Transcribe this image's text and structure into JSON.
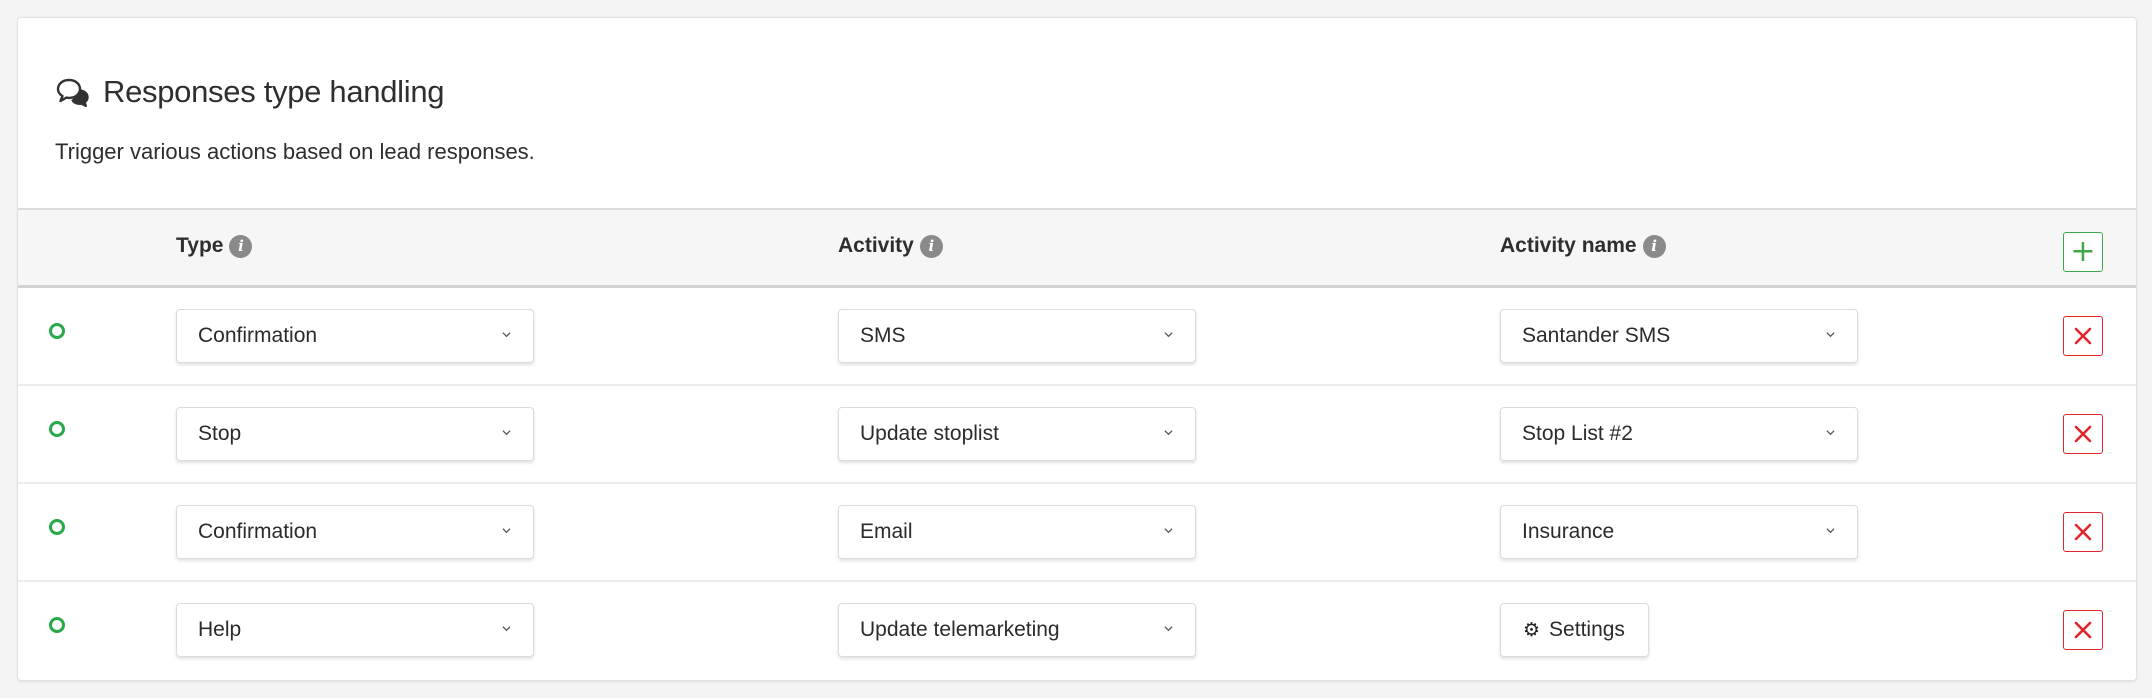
{
  "panel": {
    "title": "Responses type handling",
    "subtitle": "Trigger various actions based on lead responses.",
    "title_icon": "chat-bubbles-icon"
  },
  "columns": {
    "type": "Type",
    "activity": "Activity",
    "activity_name": "Activity name"
  },
  "add_label": "+",
  "rows": [
    {
      "type": "Confirmation",
      "activity": "SMS",
      "activity_name": "Santander SMS",
      "activity_name_kind": "select"
    },
    {
      "type": "Stop",
      "activity": "Update stoplist",
      "activity_name": "Stop List #2",
      "activity_name_kind": "select"
    },
    {
      "type": "Confirmation",
      "activity": "Email",
      "activity_name": "Insurance",
      "activity_name_kind": "select"
    },
    {
      "type": "Help",
      "activity": "Update telemarketing",
      "activity_name": "Settings",
      "activity_name_kind": "button"
    }
  ],
  "colors": {
    "status_active": "#2aa84a",
    "add_button": "#3ea849",
    "delete_button": "#e3262b"
  }
}
